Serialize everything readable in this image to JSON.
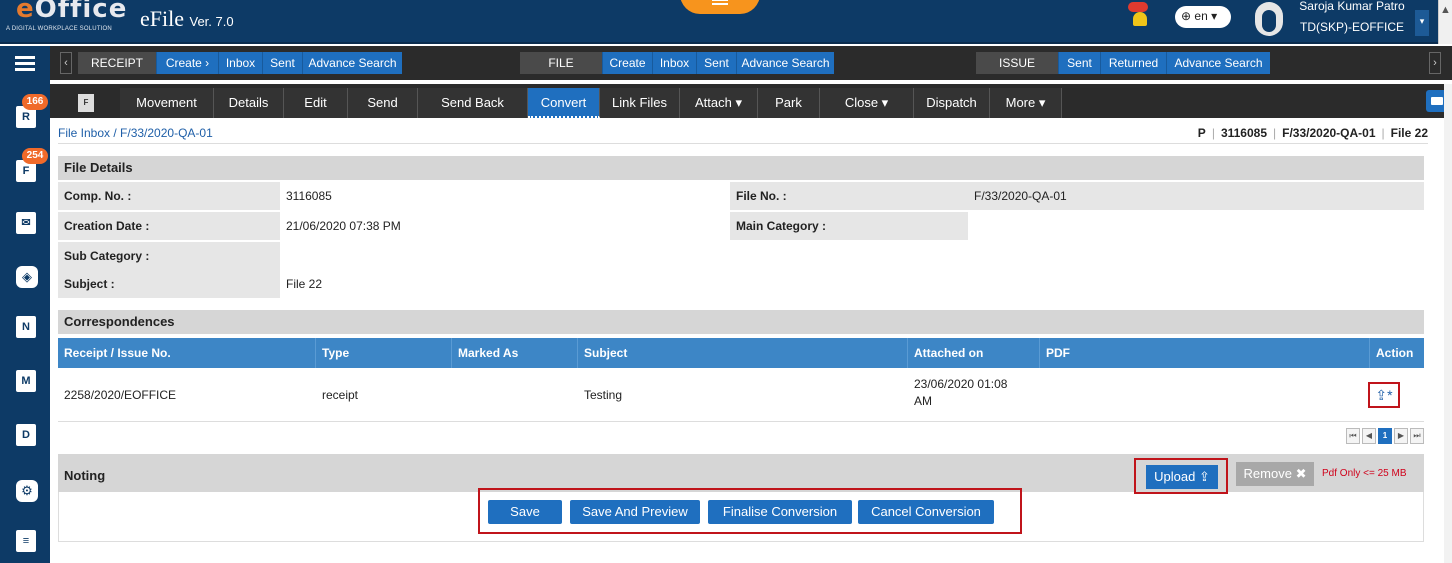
{
  "header": {
    "logo_text": "eOffice",
    "logo_tagline": "A DIGITAL WORKPLACE SOLUTION",
    "app_title": "eFile",
    "app_version": "Ver. 7.0",
    "language": "en",
    "user_name": "Saroja Kumar Patro",
    "user_role": "TD(SKP)-EOFFICE"
  },
  "sidebar": {
    "receipt_badge": "166",
    "file_badge": "254",
    "icons": [
      "menu-icon",
      "receipt-icon",
      "file-icon",
      "dak-icon",
      "collaboration-icon",
      "notice-icon",
      "meeting-icon",
      "dsc-icon",
      "settings-icon",
      "report-icon"
    ]
  },
  "nav": {
    "receipt": {
      "title": "RECEIPT",
      "items": [
        "Create ›",
        "Inbox",
        "Sent",
        "Advance Search"
      ]
    },
    "file": {
      "title": "FILE",
      "items": [
        "Create",
        "Inbox",
        "Sent",
        "Advance Search"
      ]
    },
    "issue": {
      "title": "ISSUE",
      "items": [
        "Sent",
        "Returned",
        "Advance Search"
      ]
    }
  },
  "toolbar": {
    "file_icon_text": "F",
    "buttons": [
      "Movement",
      "Details",
      "Edit",
      "Send",
      "Send Back",
      "Convert",
      "Link Files",
      "Attach ▾",
      "Park",
      "Close ▾",
      "Dispatch",
      "More ▾"
    ],
    "active": "Convert"
  },
  "breadcrumb": {
    "path": "File Inbox  /  F/33/2020-QA-01",
    "right_p": "P",
    "right_comp": "3116085",
    "right_file": "F/33/2020-QA-01",
    "right_subject": "File 22"
  },
  "file_details": {
    "title": "File Details",
    "comp_no_label": "Comp. No. :",
    "comp_no": "3116085",
    "file_no_label": "File No. :",
    "file_no": "F/33/2020-QA-01",
    "creation_date_label": "Creation Date :",
    "creation_date": "21/06/2020 07:38 PM",
    "main_category_label": "Main Category :",
    "main_category": "",
    "sub_category_label": "Sub Category :",
    "sub_category": "",
    "subject_label": "Subject :",
    "subject": "File 22"
  },
  "correspondences": {
    "title": "Correspondences",
    "columns": [
      "Receipt / Issue No.",
      "Type",
      "Marked As",
      "Subject",
      "Attached on",
      "PDF",
      "Action"
    ],
    "rows": [
      {
        "no": "2258/2020/EOFFICE",
        "type": "receipt",
        "marked_as": "",
        "subject": "Testing",
        "attached_on_1": "23/06/2020 01:08",
        "attached_on_2": "AM",
        "pdf": "",
        "action": "upload-icon"
      }
    ],
    "pager": [
      "first",
      "prev",
      "1",
      "next",
      "last"
    ]
  },
  "noting": {
    "title": "Noting",
    "upload_label": "Upload",
    "remove_label": "Remove",
    "pdf_note": "Pdf Only <= 25 MB"
  },
  "actions": {
    "save": "Save",
    "save_preview": "Save And Preview",
    "finalise": "Finalise Conversion",
    "cancel": "Cancel Conversion"
  },
  "colors": {
    "brand_navy": "#0d3a66",
    "accent_blue": "#1f6fbf",
    "table_header": "#3d86c6",
    "highlight_red": "#c0141b",
    "orange": "#f7941d"
  }
}
